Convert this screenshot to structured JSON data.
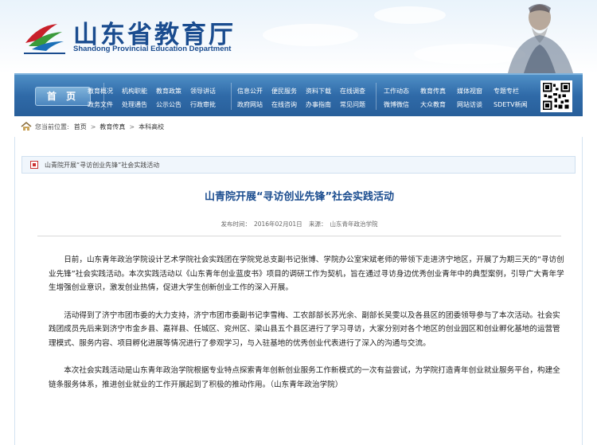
{
  "header": {
    "site_title": "山东省教育厅",
    "site_subtitle": "Shandong Provincial Education Department",
    "logo_icon": "education-department-logo-icon",
    "illustration": "confucius-figure-illustration",
    "colors": {
      "brand_blue": "#1a4c8f",
      "nav_blue": "#2f6aa8",
      "accent_red": "#c8202a",
      "accent_green": "#3a9a3a"
    }
  },
  "nav": {
    "home_label": "首 页",
    "groups": [
      {
        "row1": [
          "教育概况",
          "机构职能",
          "教育政策",
          "领导讲话"
        ],
        "row2": [
          "政务文件",
          "处理通告",
          "公示公告",
          "行政审批"
        ]
      },
      {
        "row1": [
          "信息公开",
          "便民服务",
          "资料下载",
          "在线调查"
        ],
        "row2": [
          "政府网站",
          "在线咨询",
          "办事指南",
          "常见问题"
        ]
      },
      {
        "row1": [
          "工作动态",
          "教育传真",
          "媒体视窗",
          "专题专栏"
        ],
        "row2": [
          "微博微信",
          "大众教育",
          "网站访谈",
          "SDETV新闻"
        ]
      }
    ],
    "qr_icon": "qr-code-icon"
  },
  "breadcrumb": {
    "label": "您当前位置:",
    "items": [
      "首页",
      "教育传真",
      "本科高校"
    ],
    "separator": ">"
  },
  "topic": {
    "text": "山青院开展“寻访创业先锋”社会实践活动"
  },
  "article": {
    "title": "山青院开展“寻访创业先锋”社会实践活动",
    "date_label": "发布时间：",
    "date": "2016年02月01日",
    "source_label": "来源：",
    "source": "山东青年政治学院",
    "paragraphs": [
      "日前，山东青年政治学院设计艺术学院社会实践团在学院党总支副书记张博、学院办公室宋斌老师的带领下走进济宁地区，开展了为期三天的“寻访创业先锋”社会实践活动。本次实践活动以《山东青年创业蓝皮书》项目的调研工作为契机，旨在通过寻访身边优秀创业青年中的典型案例，引导广大青年学生增强创业意识，激发创业热情，促进大学生创新创业工作的深入开展。",
      "活动得到了济宁市团市委的大力支持，济宁市团市委副书记李雪梅、工农部部长苏光余、副部长吴雯以及各县区的团委领导参与了本次活动。社会实践团成员先后来到济宁市金乡县、嘉祥县、任城区、兖州区、梁山县五个县区进行了学习寻访，大家分别对各个地区的创业园区和创业孵化基地的运营管理模式、服务内容、项目孵化进展等情况进行了参观学习，与入驻基地的优秀创业代表进行了深入的沟通与交流。",
      "本次社会实践活动是山东青年政治学院根据专业特点探索青年创新创业服务工作新模式的一次有益尝试，为学院打造青年创业就业服务平台，构建全链条服务体系，推进创业就业的工作开展起到了积极的推动作用。（山东青年政治学院）"
    ]
  }
}
